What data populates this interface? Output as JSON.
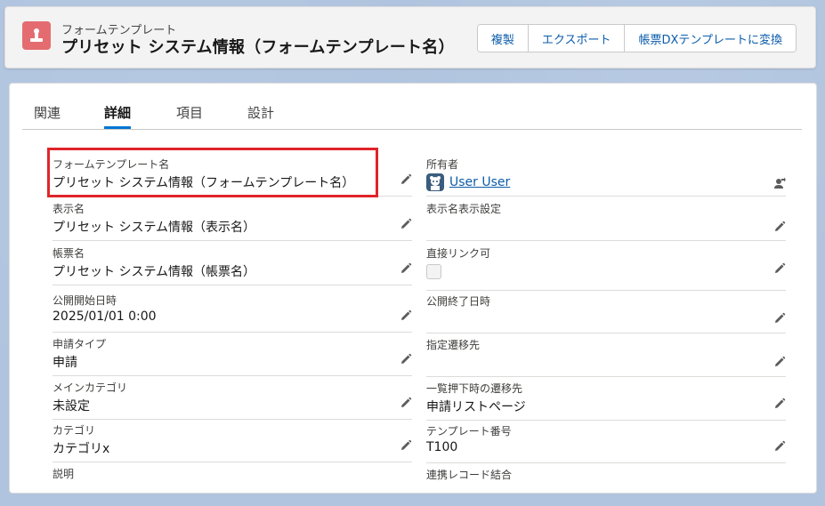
{
  "header": {
    "object_type": "フォームテンプレート",
    "record_title": "プリセット システム情報（フォームテンプレート名）",
    "buttons": [
      "複製",
      "エクスポート",
      "帳票DXテンプレートに変換"
    ]
  },
  "tabs": [
    {
      "label": "関連",
      "active": false
    },
    {
      "label": "詳細",
      "active": true
    },
    {
      "label": "項目",
      "active": false
    },
    {
      "label": "設計",
      "active": false
    }
  ],
  "fields_left": [
    {
      "label": "フォームテンプレート名",
      "value": "プリセット システム情報（フォームテンプレート名）"
    },
    {
      "label": "表示名",
      "value": "プリセット システム情報（表示名）"
    },
    {
      "label": "帳票名",
      "value": "プリセット システム情報（帳票名）"
    },
    {
      "label": "公開開始日時",
      "value": "2025/01/01 0:00"
    },
    {
      "label": "申請タイプ",
      "value": "申請"
    },
    {
      "label": "メインカテゴリ",
      "value": "未設定"
    },
    {
      "label": "カテゴリ",
      "value": "カテゴリx"
    },
    {
      "label": "説明",
      "value": ""
    }
  ],
  "fields_right": [
    {
      "label": "所有者",
      "value": "User User"
    },
    {
      "label": "表示名表示設定",
      "value": ""
    },
    {
      "label": "直接リンク可",
      "value": ""
    },
    {
      "label": "公開終了日時",
      "value": ""
    },
    {
      "label": "指定遷移先",
      "value": ""
    },
    {
      "label": "一覧押下時の遷移先",
      "value": "申請リストページ"
    },
    {
      "label": "テンプレート番号",
      "value": "T100"
    },
    {
      "label": "連携レコード結合",
      "value": ""
    }
  ],
  "colors": {
    "accent": "#0176d3",
    "link": "#0b5cab",
    "object_icon": "#e46c70",
    "highlight_border": "#e0242a"
  },
  "icons": {
    "object": "form-template-icon",
    "edit": "pencil-icon",
    "change_owner": "change-owner-icon",
    "owner_avatar": "user-avatar-icon"
  }
}
